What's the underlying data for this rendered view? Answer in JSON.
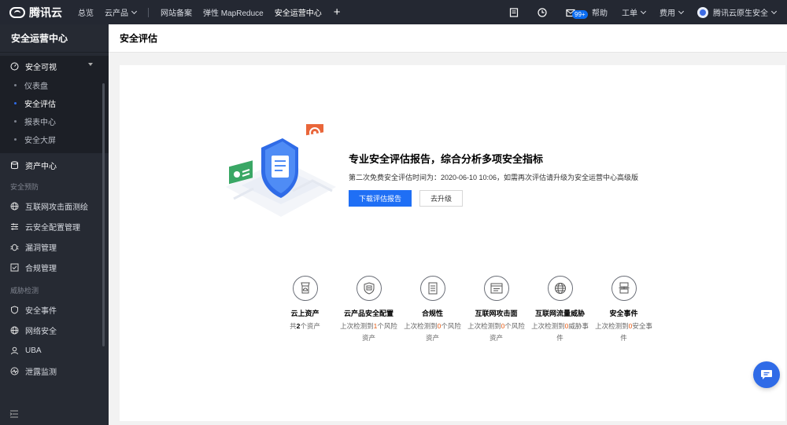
{
  "topbar": {
    "brand": "腾讯云",
    "nav": [
      "总览",
      "云产品",
      "网站备案",
      "弹性 MapReduce",
      "安全运营中心"
    ],
    "badge": "99+",
    "help": "帮助",
    "ticket": "工单",
    "billing": "费用",
    "account": "腾讯云原生安全"
  },
  "sidebar": {
    "title": "安全运营中心",
    "group": {
      "label": "安全可视",
      "items": [
        "仪表盘",
        "安全评估",
        "报表中心",
        "安全大屏"
      ],
      "active": "安全评估"
    },
    "asset": "资产中心",
    "section_prevent": "安全预防",
    "prevent_items": [
      "互联网攻击面测绘",
      "云安全配置管理",
      "漏洞管理",
      "合规管理"
    ],
    "section_detect": "威胁检测",
    "detect_items": [
      "安全事件",
      "网络安全",
      "UBA",
      "泄露监测"
    ]
  },
  "page": {
    "title": "安全评估"
  },
  "hero": {
    "title": "专业安全评估报告，综合分析多项安全指标",
    "desc": "第二次免费安全评估时间为：2020-06-10 10:06，如需再次评估请升级为安全运营中心高级版",
    "primary": "下载评估报告",
    "secondary": "去升级"
  },
  "features": [
    {
      "name": "云上资产",
      "pre": "共",
      "num": "2",
      "post": "个资产"
    },
    {
      "name": "云产品安全配置",
      "pre": "上次检测到",
      "num": "1",
      "post": "个风险资产"
    },
    {
      "name": "合规性",
      "pre": "上次检测到",
      "num": "0",
      "post": "个风险资产"
    },
    {
      "name": "互联网攻击面",
      "pre": "上次检测到",
      "num": "0",
      "post": "个风险资产"
    },
    {
      "name": "互联网流量威胁",
      "pre": "上次检测到",
      "num": "0",
      "post": "威胁事件"
    },
    {
      "name": "安全事件",
      "pre": "上次检测到",
      "num": "0",
      "post": "安全事件"
    }
  ],
  "colors": {
    "primary": "#1f6ff5",
    "highlight": "#e65a12",
    "sidebar": "#262a33",
    "topbar": "#242832"
  }
}
